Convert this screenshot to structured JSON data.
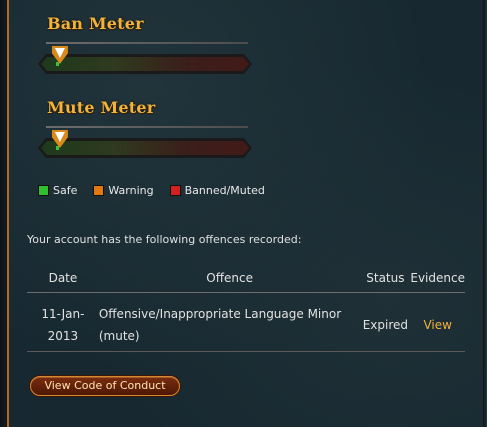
{
  "ban_meter": {
    "title": "Ban Meter",
    "level": 0.02
  },
  "mute_meter": {
    "title": "Mute Meter",
    "level": 0.02
  },
  "legend": [
    {
      "label": "Safe",
      "color": "#2fbf2f"
    },
    {
      "label": "Warning",
      "color": "#e07a10"
    },
    {
      "label": "Banned/Muted",
      "color": "#d42020"
    }
  ],
  "intro_text": "Your account has the following offences recorded:",
  "table": {
    "headers": {
      "date": "Date",
      "offence": "Offence",
      "status": "Status",
      "evidence": "Evidence"
    },
    "rows": [
      {
        "date_line1": "11-Jan-",
        "date_line2": "2013",
        "offence_line1": "Offensive/Inappropriate Language Minor",
        "offence_line2": "(mute)",
        "status": "Expired",
        "evidence": "View"
      }
    ]
  },
  "code_of_conduct_button": "View Code of Conduct",
  "colors": {
    "accent": "#f0b43c",
    "border": "#b56a1d",
    "background": "#172830"
  }
}
